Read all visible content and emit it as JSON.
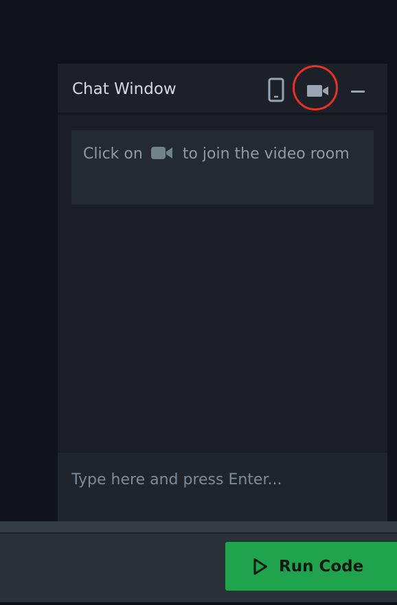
{
  "chat_window": {
    "title": "Chat Window",
    "header_icons": [
      "phone-icon",
      "video-camera-icon",
      "minimize-icon"
    ],
    "highlighted_icon": "video-camera-icon",
    "message": {
      "prefix": "Click on",
      "icon": "video-camera-icon",
      "suffix": "to join the video room"
    },
    "input": {
      "value": "",
      "placeholder": "Type here and press Enter..."
    }
  },
  "toolbar": {
    "run_label": "Run Code",
    "run_icon": "play-icon"
  },
  "colors": {
    "page_bg": "#0f141c",
    "panel_bg": "#1a1f27",
    "header_bg": "#1c2129",
    "message_bg": "#242a32",
    "accent_green": "#1fa34c",
    "highlight_red": "#e8321e",
    "icon_gray": "#9aa5b1"
  }
}
